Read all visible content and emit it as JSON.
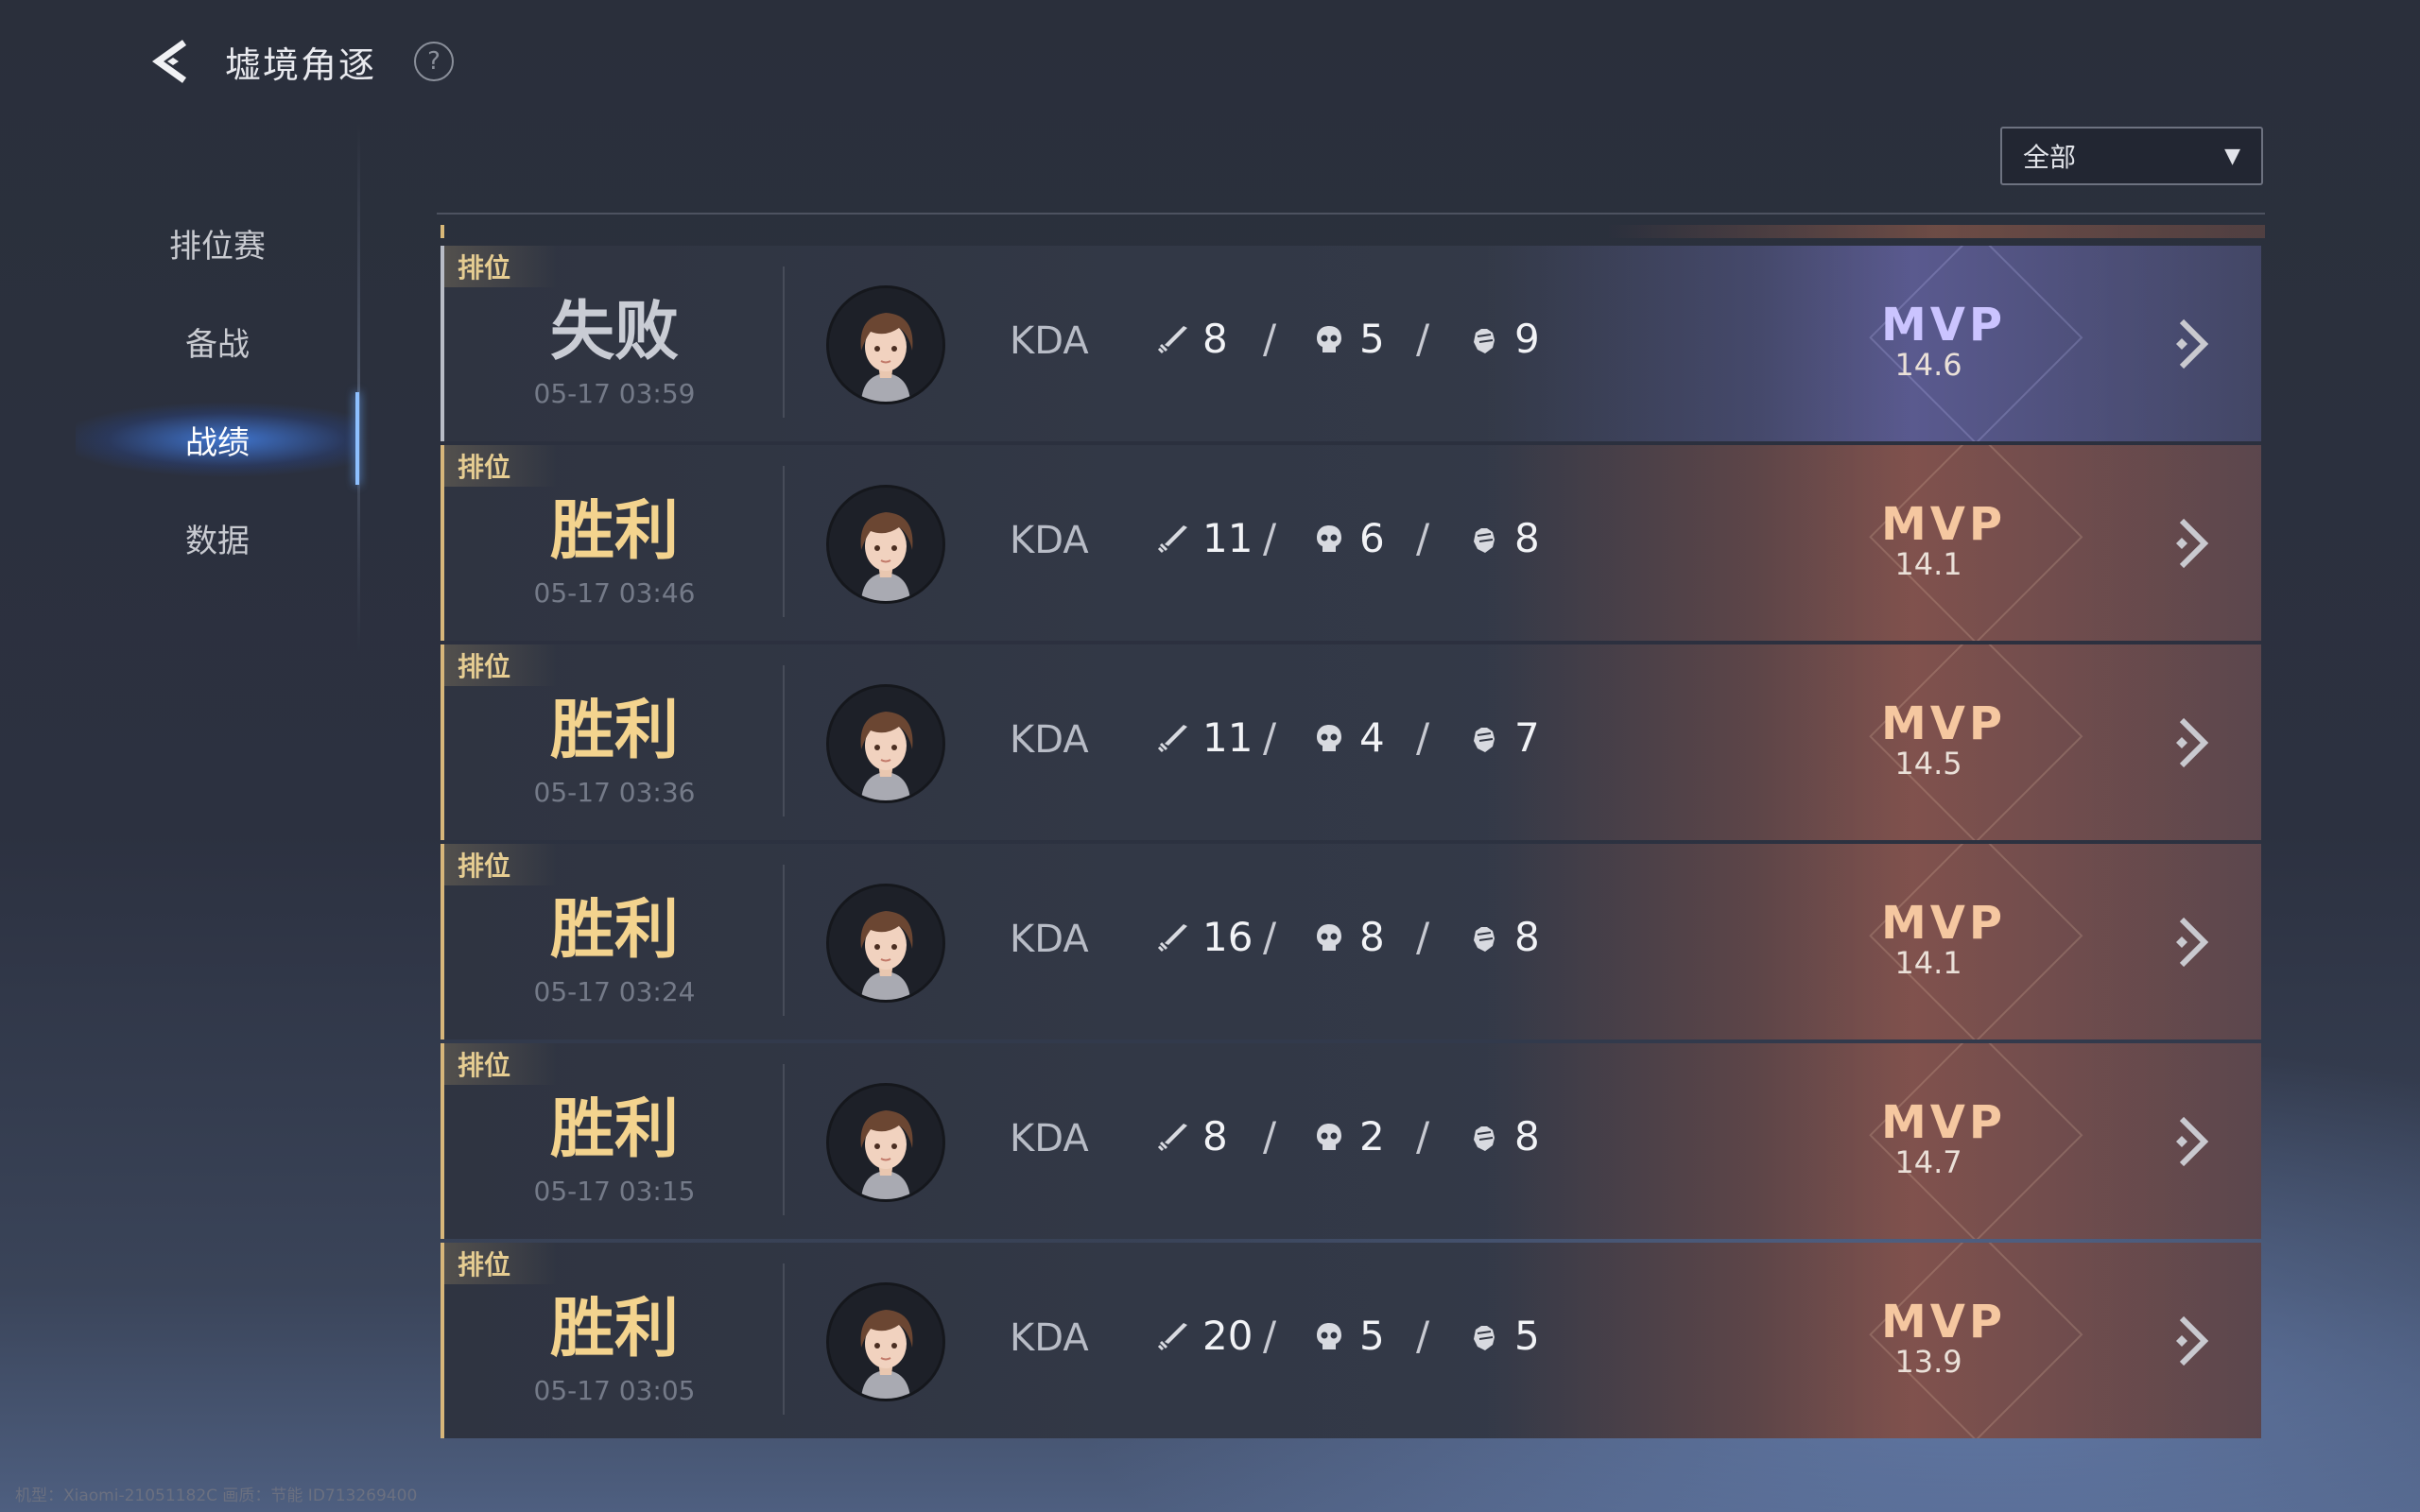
{
  "header": {
    "title": "墟境角逐",
    "back_icon": "back-arrow-icon",
    "help_label": "?"
  },
  "sidebar": {
    "items": [
      {
        "label": "排位赛",
        "active": false
      },
      {
        "label": "备战",
        "active": false
      },
      {
        "label": "战绩",
        "active": true
      },
      {
        "label": "数据",
        "active": false
      }
    ]
  },
  "filter": {
    "value": "全部",
    "arrow": "▼"
  },
  "kda_label": "KDA",
  "colors": {
    "win": "#f3d38e",
    "loss": "#c9ccd4",
    "accent": "#d7b67a",
    "mvp_win": "#f5c7a0",
    "mvp_loss": "#cbc4ff"
  },
  "matches": [
    {
      "tag": "排位",
      "result": "失败",
      "time": "05-17 03:59",
      "kills": "8",
      "deaths": "5",
      "assists": "9",
      "mvp_label": "MVP",
      "mvp_score": "14.6"
    },
    {
      "tag": "排位",
      "result": "胜利",
      "time": "05-17 03:46",
      "kills": "11",
      "deaths": "6",
      "assists": "8",
      "mvp_label": "MVP",
      "mvp_score": "14.1"
    },
    {
      "tag": "排位",
      "result": "胜利",
      "time": "05-17 03:36",
      "kills": "11",
      "deaths": "4",
      "assists": "7",
      "mvp_label": "MVP",
      "mvp_score": "14.5"
    },
    {
      "tag": "排位",
      "result": "胜利",
      "time": "05-17 03:24",
      "kills": "16",
      "deaths": "8",
      "assists": "8",
      "mvp_label": "MVP",
      "mvp_score": "14.1"
    },
    {
      "tag": "排位",
      "result": "胜利",
      "time": "05-17 03:15",
      "kills": "8",
      "deaths": "2",
      "assists": "8",
      "mvp_label": "MVP",
      "mvp_score": "14.7"
    },
    {
      "tag": "排位",
      "result": "胜利",
      "time": "05-17 03:05",
      "kills": "20",
      "deaths": "5",
      "assists": "5",
      "mvp_label": "MVP",
      "mvp_score": "13.9"
    }
  ],
  "footer": {
    "text": "机型：Xiaomi-21051182C 画质：节能 ID713269400"
  }
}
